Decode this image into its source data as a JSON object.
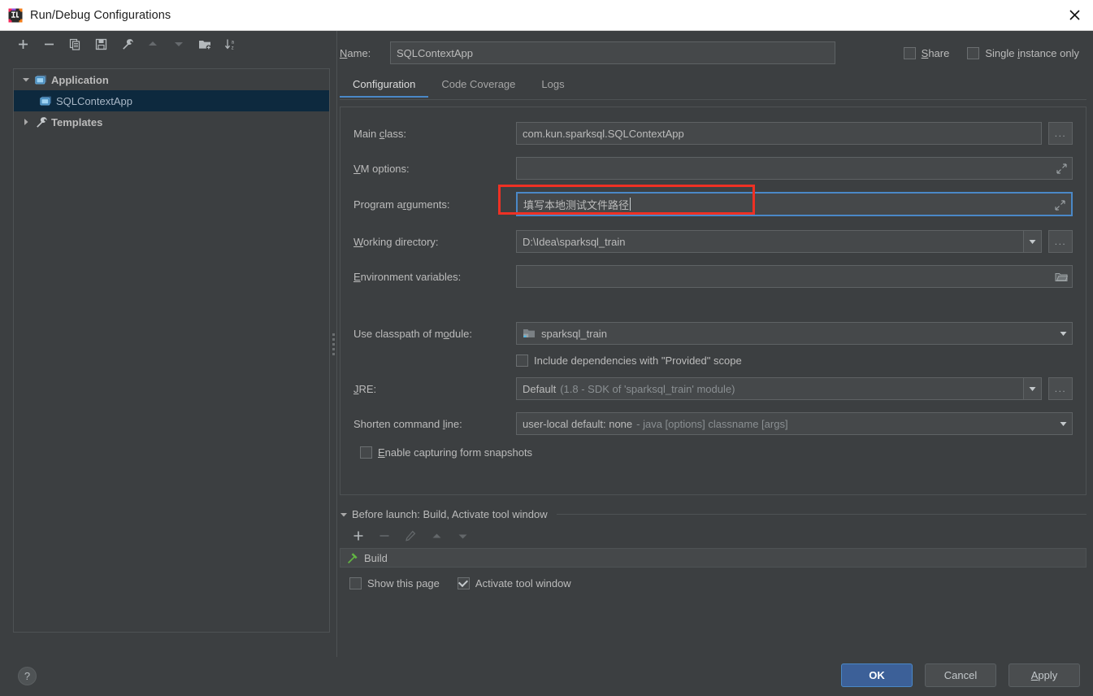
{
  "window": {
    "title": "Run/Debug Configurations",
    "app_icon": "intellij-idea-logo",
    "close_icon": "close-icon"
  },
  "tree_toolbar": {
    "buttons": [
      {
        "name": "add-configuration-button",
        "icon": "plus-icon",
        "label": "+",
        "enabled": true
      },
      {
        "name": "remove-configuration-button",
        "icon": "minus-icon",
        "label": "−",
        "enabled": true
      },
      {
        "name": "copy-configuration-button",
        "icon": "copy-icon",
        "label": "copy",
        "enabled": true
      },
      {
        "name": "save-configuration-button",
        "icon": "save-icon",
        "label": "save",
        "enabled": true
      },
      {
        "name": "edit-templates-button",
        "icon": "wrench-icon",
        "label": "wrench",
        "enabled": true
      },
      {
        "name": "move-up-button",
        "icon": "arrow-up-icon",
        "label": "up",
        "enabled": false
      },
      {
        "name": "move-down-button",
        "icon": "arrow-down-icon",
        "label": "down",
        "enabled": false
      },
      {
        "name": "new-folder-button",
        "icon": "folder-add-icon",
        "label": "folder-add",
        "enabled": true
      },
      {
        "name": "sort-alphabetically-button",
        "icon": "sort-az-icon",
        "label": "sort",
        "enabled": true
      }
    ]
  },
  "config_tree": {
    "nodes": [
      {
        "label": "Application",
        "icon": "application-icon",
        "expanded": true,
        "level": 0,
        "selected": false
      },
      {
        "label": "SQLContextApp",
        "icon": "application-icon",
        "expanded": null,
        "level": 1,
        "selected": true
      },
      {
        "label": "Templates",
        "icon": "wrench-icon",
        "expanded": false,
        "level": 0,
        "selected": false
      }
    ]
  },
  "name_field": {
    "label": "Name:",
    "label_mnemonic": "N",
    "value": "SQLContextApp",
    "placeholder": ""
  },
  "top_options": [
    {
      "name": "share-checkbox",
      "label": "Share",
      "mnemonic": "S",
      "checked": false
    },
    {
      "name": "single-instance-only-checkbox",
      "label": "Single instance only",
      "mnemonic": "i",
      "checked": false
    }
  ],
  "tabs": [
    {
      "label": "Configuration",
      "active": true
    },
    {
      "label": "Code Coverage",
      "active": false
    },
    {
      "label": "Logs",
      "active": false
    }
  ],
  "fields": {
    "main_class": {
      "label": "Main class:",
      "value": "com.kun.sparksql.SQLContextApp",
      "browse_label": "...",
      "browse_icon": "ellipsis-icon"
    },
    "vm_options": {
      "label": "VM options:",
      "value": "",
      "expand_icon": "expand-diagonal-icon"
    },
    "program_arguments": {
      "label": "Program arguments:",
      "value": "填写本地测试文件路径",
      "expand_icon": "expand-diagonal-icon",
      "focused": true,
      "annotation_color": "#ee3124",
      "focus_color": "#4a88c7"
    },
    "working_directory": {
      "label": "Working directory:",
      "value": "D:\\Idea\\sparksql_train",
      "dropdown_icon": "chevron-down-icon",
      "browse_label": "...",
      "browse_icon": "ellipsis-icon"
    },
    "environment_variables": {
      "label": "Environment variables:",
      "value": "",
      "browse_icon": "folder-icon"
    },
    "use_classpath_of_module": {
      "label": "Use classpath of module:",
      "value": "sparksql_train",
      "value_icon": "module-icon",
      "dropdown_icon": "chevron-down-icon"
    },
    "include_provided_scope": {
      "name": "include-provided-dependencies-checkbox",
      "label": "Include dependencies with \"Provided\" scope",
      "checked": false
    },
    "jre": {
      "label": "JRE:",
      "value": "Default",
      "value_detail": "(1.8 - SDK of 'sparksql_train' module)",
      "dropdown_icon": "chevron-down-icon",
      "browse_label": "...",
      "browse_icon": "ellipsis-icon"
    },
    "shorten_command_line": {
      "label": "Shorten command line:",
      "value": "user-local default: none",
      "value_detail": "- java [options] classname [args]",
      "dropdown_icon": "chevron-down-icon"
    },
    "enable_form_snapshots": {
      "name": "enable-capturing-form-snapshots-checkbox",
      "label": "Enable capturing form snapshots",
      "checked": false
    }
  },
  "before_launch": {
    "title": "Before launch: Build, Activate tool window",
    "expanded": true,
    "toolbar": [
      {
        "name": "add-task-button",
        "icon": "plus-icon",
        "enabled": true
      },
      {
        "name": "remove-task-button",
        "icon": "minus-icon",
        "enabled": false
      },
      {
        "name": "edit-task-button",
        "icon": "pencil-icon",
        "enabled": false
      },
      {
        "name": "move-task-up-button",
        "icon": "arrow-up-icon",
        "enabled": false
      },
      {
        "name": "move-task-down-button",
        "icon": "arrow-down-icon",
        "enabled": false
      }
    ],
    "tasks": [
      {
        "label": "Build",
        "icon": "hammer-icon",
        "icon_color": "#62b543"
      }
    ],
    "options": [
      {
        "name": "show-this-page-checkbox",
        "label": "Show this page",
        "checked": false
      },
      {
        "name": "activate-tool-window-checkbox",
        "label": "Activate tool window",
        "checked": true
      }
    ]
  },
  "footer": {
    "help_label": "?",
    "help_icon": "help-icon",
    "buttons": [
      {
        "name": "ok-button",
        "label": "OK",
        "primary": true,
        "mnemonic": ""
      },
      {
        "name": "cancel-button",
        "label": "Cancel",
        "primary": false,
        "mnemonic": ""
      },
      {
        "name": "apply-button",
        "label": "Apply",
        "primary": false,
        "mnemonic": "A"
      }
    ]
  },
  "colors": {
    "dialog_background": "#3c3f41",
    "field_background": "#45484a",
    "border": "#4e5254",
    "accent_blue": "#4a88c7",
    "selection_blue": "#0d293e",
    "text": "#bbbbbb",
    "muted_text": "#8a8f92",
    "annotation_red": "#ee3124",
    "build_green": "#62b543",
    "titlebar_background": "#ffffff"
  }
}
